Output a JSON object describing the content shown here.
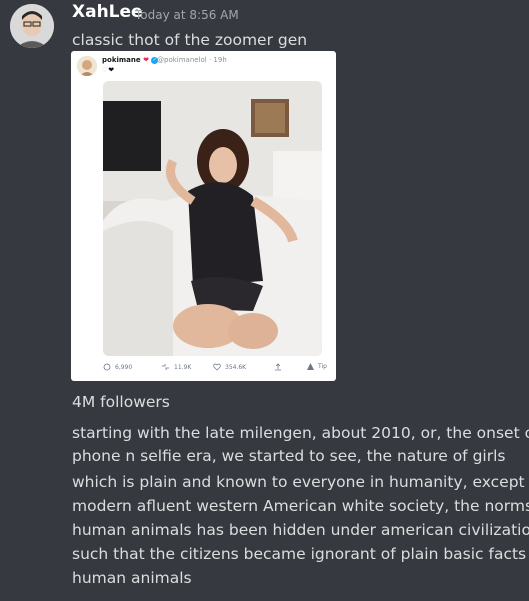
{
  "message": {
    "author": "XahLee",
    "timestamp": "Today at 8:56 AM",
    "text_line1": "classic thot of the zoomer gen",
    "text_followers": "4M followers",
    "text_para1_line1": "starting with the late milengen, about 2010, or, the onset of",
    "text_para1_line2": "phone n selfie era, we started to see, the nature of girls",
    "text_para2_line1": "which is plain and known to everyone in humanity, except in",
    "text_para2_line2": "modern afluent western American white society, the norms of",
    "text_para2_line3": "human animals has been hidden under american civilization,",
    "text_para2_line4": "such that the citizens became ignorant of plain basic facts of",
    "text_para2_line5": "human animals"
  },
  "tweet": {
    "name": "pokimane",
    "badges": "❤️ ✔",
    "handle": "@pokimanelol · 19h",
    "emoji_line": "🤍🖤",
    "replies": "6,990",
    "retweets": "11.9K",
    "likes": "354.6K",
    "tip": "Tip"
  },
  "colors": {
    "background": "#36393f",
    "username": "#ffffff",
    "text": "#dcddde",
    "timestamp": "#a3a6aa",
    "embed_bg": "#ffffff"
  }
}
